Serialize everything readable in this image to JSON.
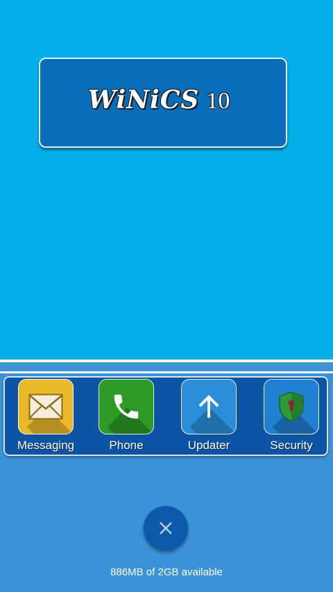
{
  "header": {
    "title_word": "WiNiCS",
    "title_number": "10"
  },
  "dock": {
    "items": [
      {
        "label": "Messaging",
        "icon": "envelope-icon",
        "color": "#e9b92b"
      },
      {
        "label": "Phone",
        "icon": "phone-handset-icon",
        "color": "#2e9a26"
      },
      {
        "label": "Updater",
        "icon": "up-arrow-icon",
        "color": "#2a8fd8"
      },
      {
        "label": "Security",
        "icon": "shield-lock-icon",
        "color": "#1f7fd0"
      }
    ]
  },
  "footer": {
    "close_icon": "close-icon",
    "memory_text": "886MB of 2GB available"
  },
  "colors": {
    "top_background": "#04aee9",
    "bottom_background": "#3a92d8",
    "card_fill": "#086dbb",
    "dock_fill": "#0d54a4"
  }
}
